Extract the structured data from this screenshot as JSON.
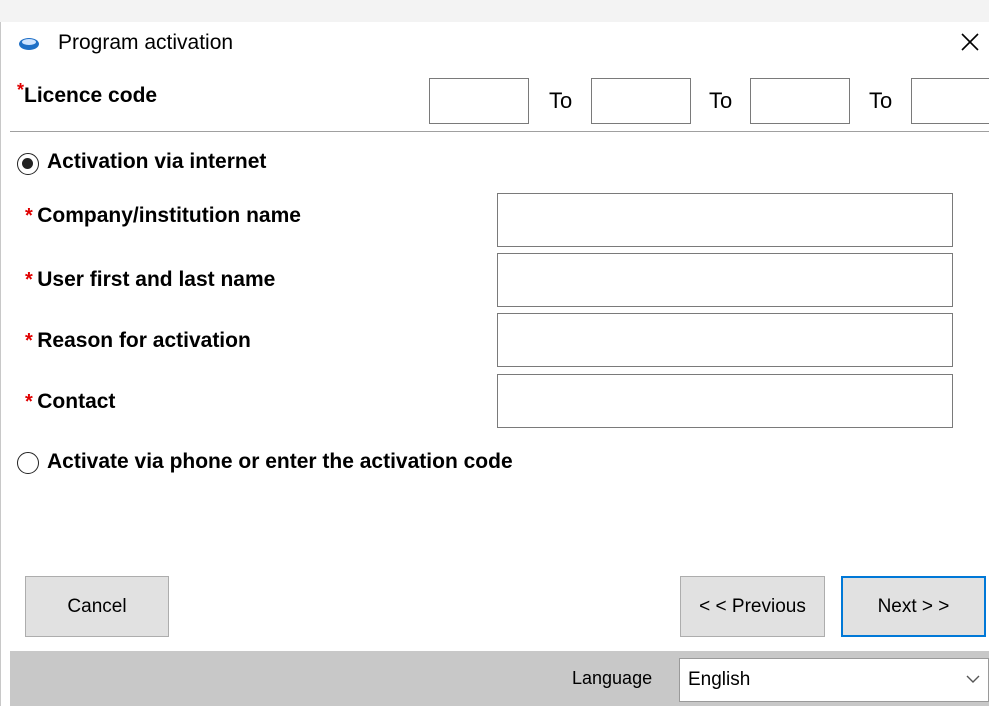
{
  "window": {
    "title": "Program activation",
    "icons": {
      "app": "app-logo-icon",
      "close": "close-icon"
    }
  },
  "licence": {
    "required_mark": "*",
    "label": "Licence code",
    "separator": "To",
    "codes": [
      "",
      "",
      "",
      ""
    ]
  },
  "internet": {
    "option_label": "Activation via internet",
    "selected": true,
    "fields": [
      {
        "required_mark": "*",
        "label": "Company/institution name",
        "value": ""
      },
      {
        "required_mark": "*",
        "label": "User first and last name",
        "value": ""
      },
      {
        "required_mark": "*",
        "label": "Reason for activation",
        "value": ""
      },
      {
        "required_mark": "*",
        "label": "Contact",
        "value": ""
      }
    ]
  },
  "phone": {
    "option_label": "Activate via phone or enter the activation code",
    "selected": false
  },
  "buttons": {
    "cancel": "Cancel",
    "previous": "< < Previous",
    "next": "Next > >"
  },
  "footer": {
    "language_label": "Language",
    "language_value": "English"
  },
  "colors": {
    "required": "#e00000",
    "accent": "#0078d7",
    "footer_bg": "#c8c8c8"
  }
}
